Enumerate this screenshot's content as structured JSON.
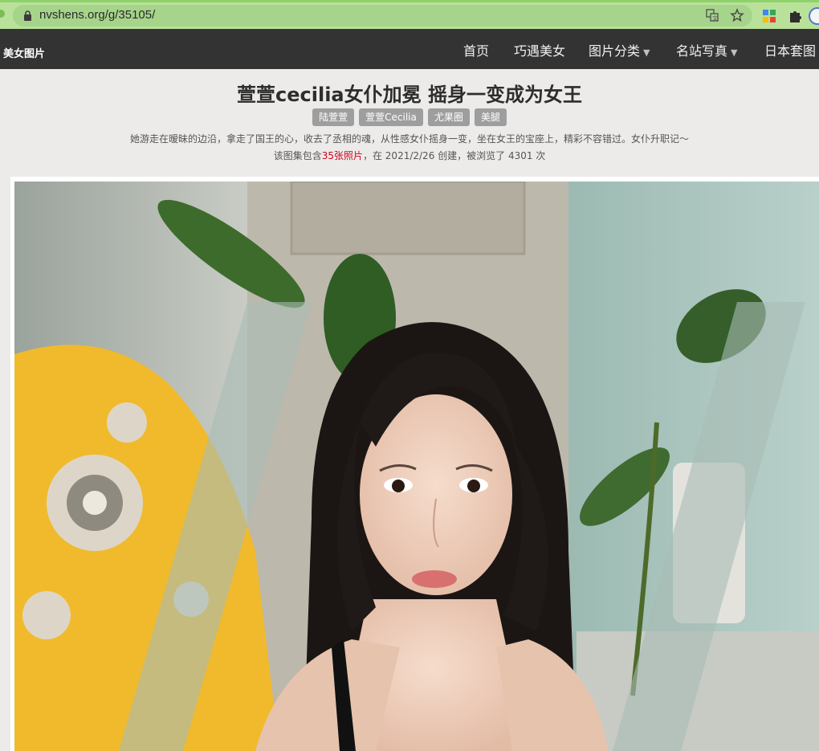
{
  "browser": {
    "url": "nvshens.org/g/35105/"
  },
  "site": {
    "brand": "美女图片",
    "nav": [
      {
        "label": "首页",
        "has_menu": false
      },
      {
        "label": "巧遇美女",
        "has_menu": false
      },
      {
        "label": "图片分类",
        "has_menu": true
      },
      {
        "label": "名站写真",
        "has_menu": true
      },
      {
        "label": "日本套图",
        "has_menu": false
      }
    ]
  },
  "gallery": {
    "title": "萱萱cecilia女仆加冕 摇身一变成为女王",
    "tags": [
      "陆萱萱",
      "萱萱Cecilia",
      "尤果圈",
      "美腿"
    ],
    "description": "她游走在暧昧的边沿，拿走了国王的心，收去了丞相的魂，从性感女仆摇身一变，坐在女王的宝座上，精彩不容错过。女仆升职记～",
    "meta_prefix": "该图集包含",
    "photo_count": "35张照片",
    "meta_suffix": "，在 2021/2/26 创建，被浏览了 4301 次"
  },
  "colors": {
    "nav_bg": "#333333",
    "tag_bg": "#9e9e9e",
    "count_highlight": "#d0021b",
    "chrome_bg": "#b9e19a"
  },
  "icons": {
    "lock": "lock-icon",
    "translate": "translate-icon",
    "bookmark": "star-icon",
    "apps": "apps-icon",
    "extensions": "puzzle-icon",
    "profile": "avatar"
  }
}
